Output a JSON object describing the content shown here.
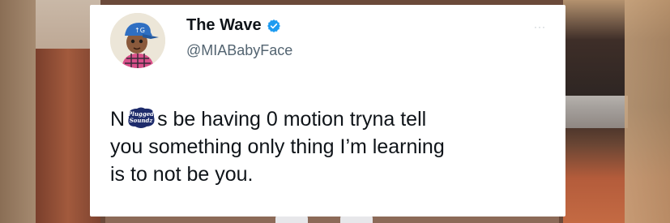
{
  "tweet": {
    "display_name": "The Wave",
    "handle": "@MIABabyFace",
    "more_label": "···",
    "text_line1_start": "N",
    "text_line1_end": "s be having 0 motion tryna tell",
    "text_line2": "you something only thing I’m learning",
    "text_line3": "is to not be you.",
    "watermark_text": "Plugged Soundz"
  },
  "colors": {
    "text": "#0f1419",
    "secondary_text": "#536471",
    "verified_blue": "#1d9bf0",
    "card_background": "#ffffff"
  },
  "icons": {
    "verified": "verified-badge-icon",
    "more": "more-options-icon"
  }
}
